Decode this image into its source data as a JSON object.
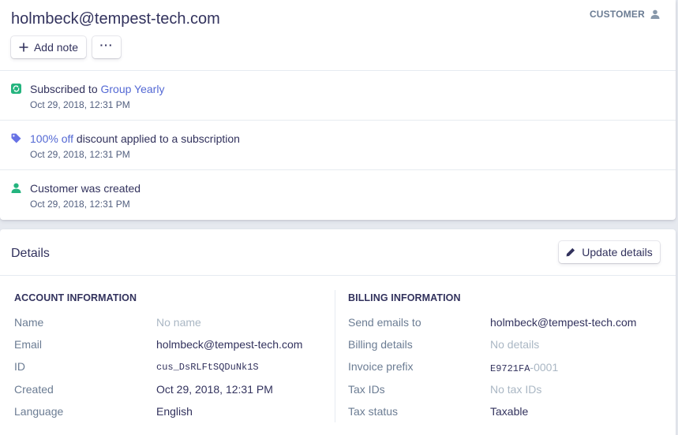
{
  "header": {
    "email": "holmbeck@tempest-tech.com",
    "role": "CUSTOMER",
    "add_note_label": "Add note",
    "more_label": "···"
  },
  "timeline": [
    {
      "icon": "subscription-icon",
      "prefix": "Subscribed to ",
      "link": "Group Yearly",
      "suffix": "",
      "date": "Oct 29, 2018, 12:31 PM"
    },
    {
      "icon": "tag-icon",
      "prefix": "",
      "link": "100% off",
      "suffix": " discount applied to a subscription",
      "date": "Oct 29, 2018, 12:31 PM"
    },
    {
      "icon": "user-icon",
      "prefix": "Customer was created",
      "link": "",
      "suffix": "",
      "date": "Oct 29, 2018, 12:31 PM"
    }
  ],
  "details": {
    "title": "Details",
    "update_label": "Update details",
    "account": {
      "title": "ACCOUNT INFORMATION",
      "rows": [
        {
          "label": "Name",
          "value": "No name"
        },
        {
          "label": "Email",
          "value": "holmbeck@tempest-tech.com"
        },
        {
          "label": "ID",
          "value": "cus_DsRLFtSQDuNk1S"
        },
        {
          "label": "Created",
          "value": "Oct 29, 2018, 12:31 PM"
        },
        {
          "label": "Language",
          "value": "English"
        }
      ]
    },
    "billing": {
      "title": "BILLING INFORMATION",
      "rows": [
        {
          "label": "Send emails to",
          "value": "holmbeck@tempest-tech.com"
        },
        {
          "label": "Billing details",
          "value": "No details"
        },
        {
          "label": "Invoice prefix",
          "value": "E9721FA",
          "value_suffix": "-0001"
        },
        {
          "label": "Tax IDs",
          "value": "No tax IDs"
        },
        {
          "label": "Tax status",
          "value": "Taxable"
        }
      ]
    }
  },
  "colors": {
    "link": "#5469d4",
    "subscription_icon": "#24b47e",
    "tag_icon": "#6772e5",
    "user_icon": "#24b47e"
  }
}
